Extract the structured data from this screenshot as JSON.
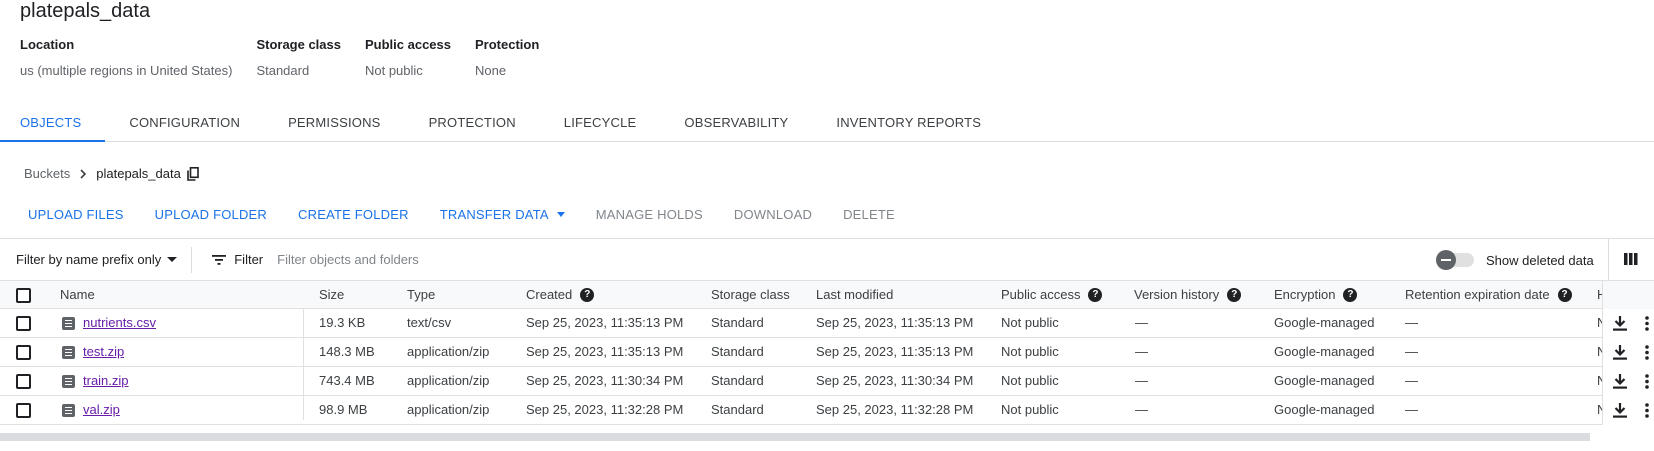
{
  "bucket": {
    "title": "platepals_data",
    "meta": [
      {
        "key": "Location",
        "value": "us (multiple regions in United States)"
      },
      {
        "key": "Storage class",
        "value": "Standard"
      },
      {
        "key": "Public access",
        "value": "Not public"
      },
      {
        "key": "Protection",
        "value": "None"
      }
    ]
  },
  "tabs": [
    "OBJECTS",
    "CONFIGURATION",
    "PERMISSIONS",
    "PROTECTION",
    "LIFECYCLE",
    "OBSERVABILITY",
    "INVENTORY REPORTS"
  ],
  "active_tab": "OBJECTS",
  "breadcrumb": {
    "root": "Buckets",
    "current": "platepals_data"
  },
  "actions": {
    "upload_files": "UPLOAD FILES",
    "upload_folder": "UPLOAD FOLDER",
    "create_folder": "CREATE FOLDER",
    "transfer_data": "TRANSFER DATA",
    "manage_holds": "MANAGE HOLDS",
    "download": "DOWNLOAD",
    "delete": "DELETE"
  },
  "filter": {
    "prefix_label": "Filter by name prefix only",
    "filter_label": "Filter",
    "placeholder": "Filter objects and folders",
    "show_deleted_label": "Show deleted data"
  },
  "table": {
    "headers": {
      "name": "Name",
      "size": "Size",
      "type": "Type",
      "created": "Created",
      "storage_class": "Storage class",
      "last_modified": "Last modified",
      "public_access": "Public access",
      "version_history": "Version history",
      "encryption": "Encryption",
      "retention": "Retention expiration date",
      "truncated": "H"
    },
    "rows": [
      {
        "name": "nutrients.csv",
        "size": "19.3 KB",
        "type": "text/csv",
        "created": "Sep 25, 2023, 11:35:13 PM",
        "storage_class": "Standard",
        "last_modified": "Sep 25, 2023, 11:35:13 PM",
        "public_access": "Not public",
        "version_history": "—",
        "encryption": "Google-managed",
        "retention": "—",
        "truncated": "N"
      },
      {
        "name": "test.zip",
        "size": "148.3 MB",
        "type": "application/zip",
        "created": "Sep 25, 2023, 11:35:13 PM",
        "storage_class": "Standard",
        "last_modified": "Sep 25, 2023, 11:35:13 PM",
        "public_access": "Not public",
        "version_history": "—",
        "encryption": "Google-managed",
        "retention": "—",
        "truncated": "N"
      },
      {
        "name": "train.zip",
        "size": "743.4 MB",
        "type": "application/zip",
        "created": "Sep 25, 2023, 11:30:34 PM",
        "storage_class": "Standard",
        "last_modified": "Sep 25, 2023, 11:30:34 PM",
        "public_access": "Not public",
        "version_history": "—",
        "encryption": "Google-managed",
        "retention": "—",
        "truncated": "N"
      },
      {
        "name": "val.zip",
        "size": "98.9 MB",
        "type": "application/zip",
        "created": "Sep 25, 2023, 11:32:28 PM",
        "storage_class": "Standard",
        "last_modified": "Sep 25, 2023, 11:32:28 PM",
        "public_access": "Not public",
        "version_history": "—",
        "encryption": "Google-managed",
        "retention": "—",
        "truncated": "N"
      }
    ]
  },
  "colors": {
    "accent": "#1a73e8",
    "link_visited": "#681da8",
    "muted": "#5f6368",
    "border": "#e0e0e0"
  }
}
